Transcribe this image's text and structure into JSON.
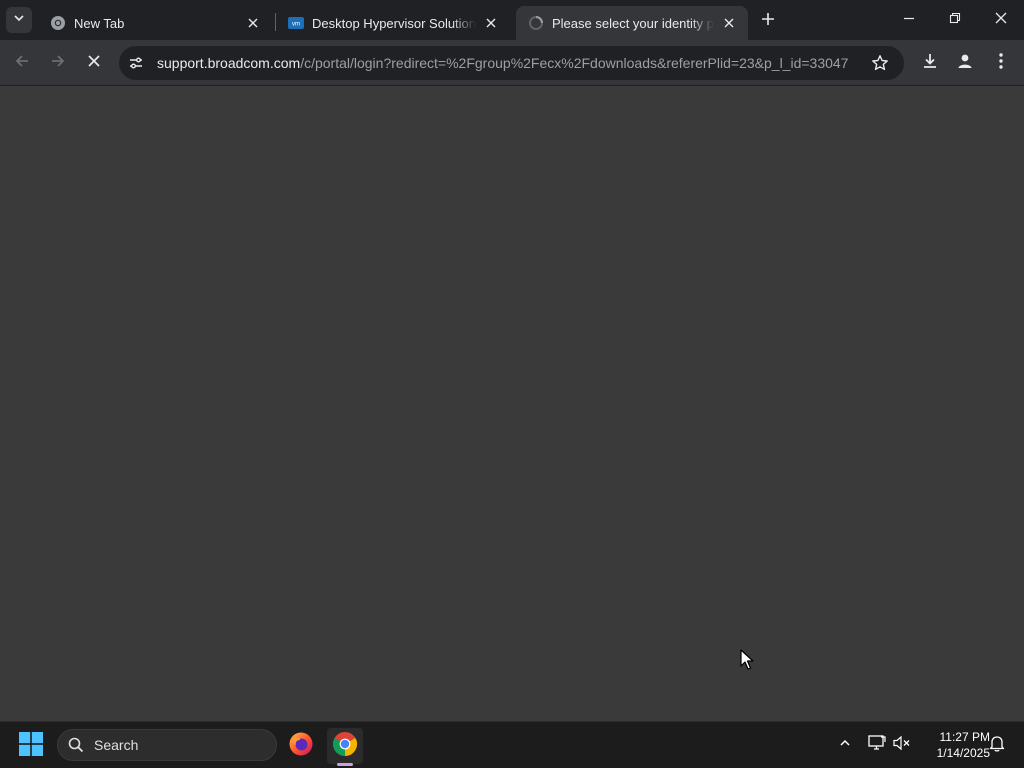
{
  "browser": {
    "tabs": [
      {
        "title": "New Tab",
        "active": false,
        "favicon": "chrome-icon"
      },
      {
        "title": "Desktop Hypervisor Solutions |",
        "active": false,
        "favicon": "vmware-icon"
      },
      {
        "title": "Please select your identity provider",
        "active": true,
        "favicon": "loading-spinner-icon"
      }
    ],
    "address_bar": {
      "host": "support.broadcom.com",
      "path": "/c/portal/login?redirect=%2Fgroup%2Fecx%2Fdownloads&refererPlid=23&p_l_id=33047"
    },
    "accent_color": "#8ab4f8"
  },
  "taskbar": {
    "search_label": "Search",
    "time": "11:27 PM",
    "date": "1/14/2025",
    "pinned_apps": [
      "firefox-icon",
      "chrome-icon"
    ]
  },
  "colors": {
    "content_bg": "#3a3a3a",
    "toolbar_bg": "#35363a",
    "tabstrip_bg": "#202124",
    "taskbar_bg": "#1c1c1c"
  }
}
